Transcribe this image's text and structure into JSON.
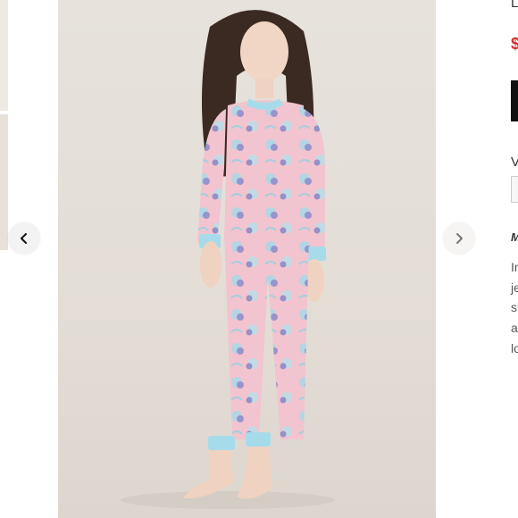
{
  "carousel": {
    "prev_icon": "chevron-left-icon",
    "next_icon": "chevron-right-icon"
  },
  "photo": {
    "subject": "child wearing pink floral long-sleeve pajama set with light blue cuffs"
  },
  "detail": {
    "title_fragment": "L",
    "price_fragment": "$",
    "variant_label_fragment": "V",
    "section_fragment": "M",
    "description_fragments": [
      "In",
      "je",
      "sl",
      "a",
      "lo"
    ]
  },
  "colors": {
    "pajama_pink": "#f2c4cf",
    "cuff_blue": "#a6dcea",
    "price_red": "#d32f2f",
    "background": "#e5e0da"
  }
}
